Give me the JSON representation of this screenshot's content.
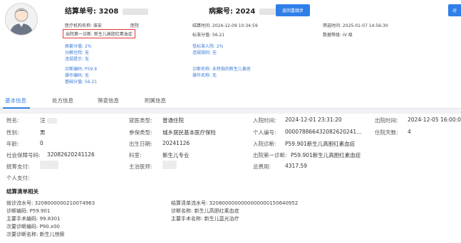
{
  "header": {
    "settlement_label": "结算单号: 3208",
    "case_label": "病案号: 2024",
    "return_button": "返回重跳步",
    "right_button": "对"
  },
  "info": {
    "org": "医疗机构名称: 淮安",
    "org_type": "医院",
    "first_diag": "出院第一诊断: 新生儿高胆红素血症",
    "settle_time": "结算时间: 2024-12-09 10:34:59",
    "std_score": "标准分值: 56.21",
    "filter_time": "筛选时间: 2025-01-07 14:56:30",
    "data_level": "数据等级: IV 级"
  },
  "metrics_left": [
    "高套分值: 2%",
    "分解住院: 无",
    "违规提示: 无"
  ],
  "metrics_right": [
    "低标准入院: 2%",
    "违规规则: 无"
  ],
  "diag_left": [
    "诊断编码: P59.9",
    "操作编码: 无",
    "基础分值: 56.21"
  ],
  "diag_right": [
    "诊断名称: 未特指的新生儿黄疸",
    "操作名称: 无"
  ],
  "tabs": [
    "基本信息",
    "处方信息",
    "筛查信息",
    "附属信息"
  ],
  "basic": {
    "name_k": "姓名:",
    "name_v": "汪",
    "gender_k": "性别:",
    "gender_v": "男",
    "age_k": "年龄:",
    "age_v": "0",
    "ssn_k": "社会保障号码:",
    "ssn_v": "32082620241126",
    "pool_k": "统筹支付:",
    "self_k": "个人支付:",
    "visit_type_k": "就医类型:",
    "visit_type_v": "普通住院",
    "ins_type_k": "参保类型:",
    "ins_type_v": "城乡居民基本医疗保险",
    "birth_k": "出生日期:",
    "birth_v": "20241126",
    "dept_k": "科室:",
    "dept_v": "新生儿专业",
    "doctor_k": "主治医师:",
    "admit_k": "入院时间:",
    "admit_v": "2024-12-01 23:31:20",
    "pid_k": "个人编号:",
    "pid_v": "000078866432082620241...",
    "admit_diag_k": "入院诊断:",
    "admit_diag_v": "P59.901新生儿高胆红素血症",
    "out_diag_k": "出院第一诊断:",
    "out_diag_v": "P59.901新生儿高胆红素血症",
    "total_k": "总费用:",
    "total_v": "4317.59",
    "discharge_k": "出院时间:",
    "discharge_v": "2024-12-05 16:00:06",
    "days_k": "住院天数:",
    "days_v": "4"
  },
  "settlement": {
    "title": "结算清单相关",
    "left": [
      "就诊流水号: 32080000002100749​63",
      "诊断编码:    P59.901",
      "主要手术编码: 99.8301",
      "次要诊断编码: P90.x00",
      "次要诊断名称: 新生儿惊厥"
    ],
    "right": [
      "结算清单流水号: 3208000000000000000150640952",
      "诊断名称:     新生儿高胆红素血症",
      "主要手术名称: 新生儿蓝光治疗"
    ]
  }
}
